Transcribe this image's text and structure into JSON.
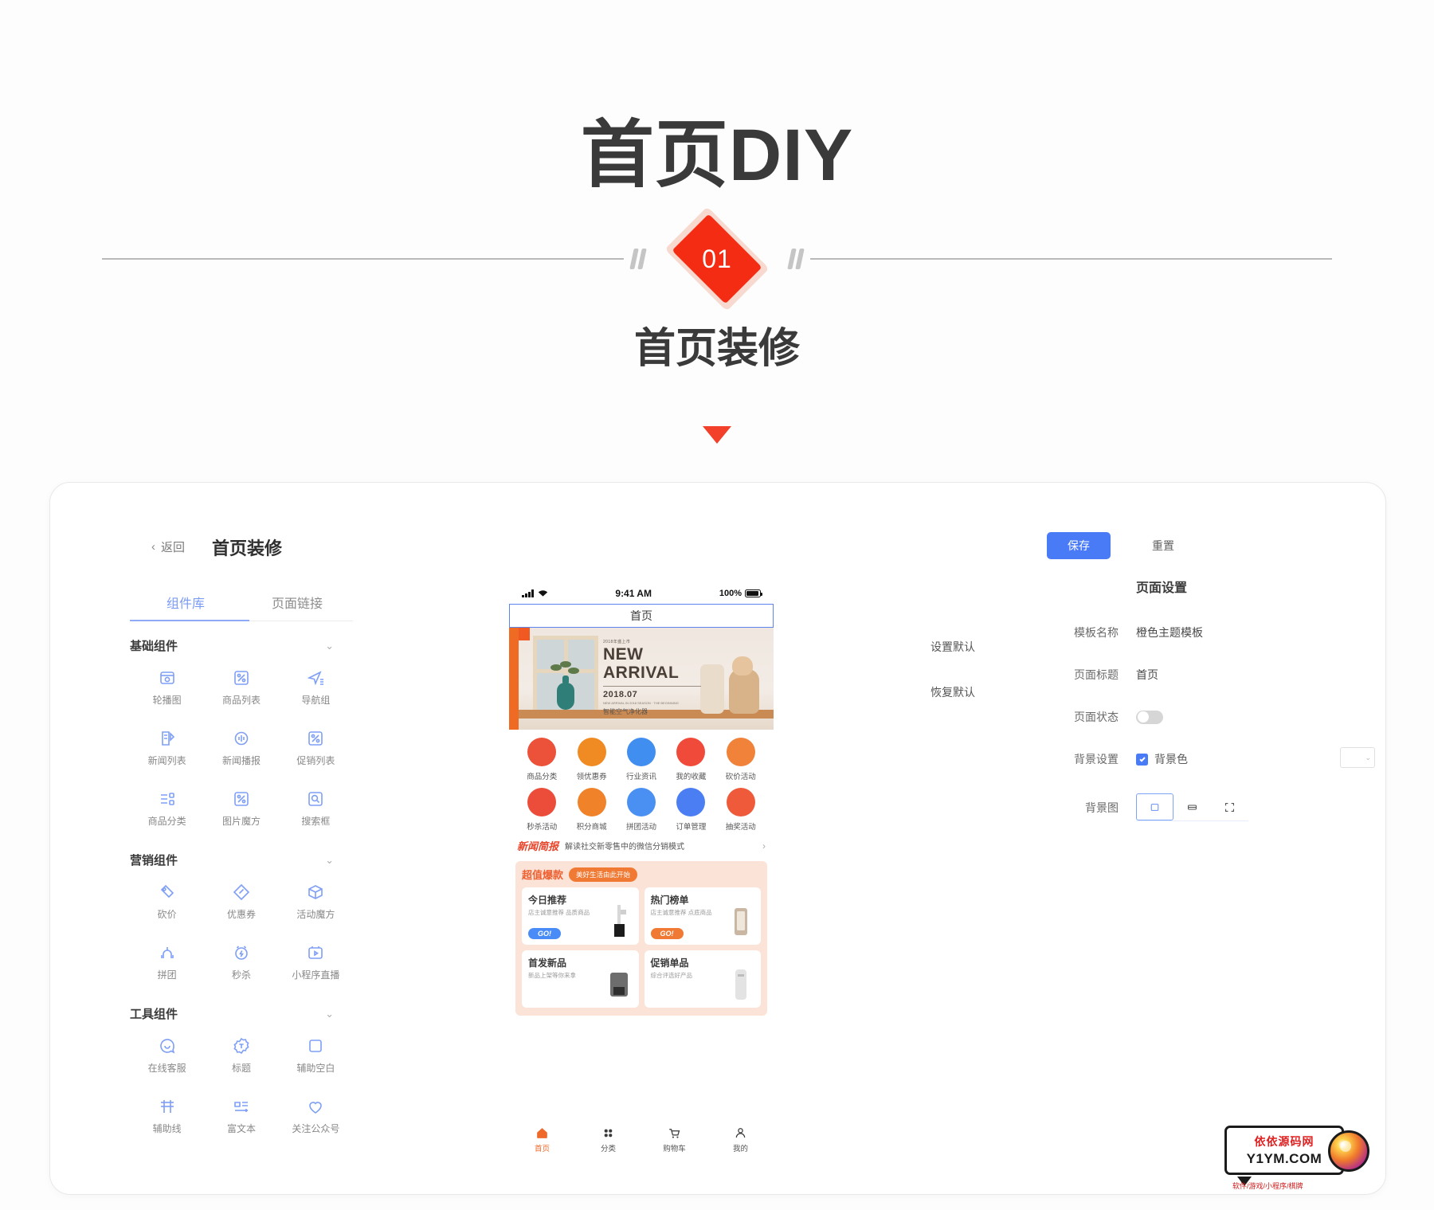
{
  "hero": {
    "title": "首页DIY",
    "badge_number": "01",
    "subtitle": "首页装修"
  },
  "app": {
    "back_label": "返回",
    "title": "首页装修",
    "save_label": "保存",
    "reset_label": "重置"
  },
  "left_panel": {
    "tabs": [
      {
        "label": "组件库",
        "active": true
      },
      {
        "label": "页面链接",
        "active": false
      }
    ],
    "groups": [
      {
        "name": "基础组件",
        "items": [
          {
            "label": "轮播图",
            "icon": "carousel-icon"
          },
          {
            "label": "商品列表",
            "icon": "product-list-icon"
          },
          {
            "label": "导航组",
            "icon": "navigation-group-icon"
          },
          {
            "label": "新闻列表",
            "icon": "news-list-icon"
          },
          {
            "label": "新闻播报",
            "icon": "news-broadcast-icon"
          },
          {
            "label": "促销列表",
            "icon": "promotion-list-icon"
          },
          {
            "label": "商品分类",
            "icon": "product-category-icon"
          },
          {
            "label": "图片魔方",
            "icon": "image-cube-icon"
          },
          {
            "label": "搜索框",
            "icon": "search-box-icon"
          }
        ]
      },
      {
        "name": "营销组件",
        "items": [
          {
            "label": "砍价",
            "icon": "bargain-icon"
          },
          {
            "label": "优惠券",
            "icon": "coupon-icon"
          },
          {
            "label": "活动魔方",
            "icon": "activity-cube-icon"
          },
          {
            "label": "拼团",
            "icon": "group-buy-icon"
          },
          {
            "label": "秒杀",
            "icon": "flash-sale-icon"
          },
          {
            "label": "小程序直播",
            "icon": "miniapp-live-icon"
          }
        ]
      },
      {
        "name": "工具组件",
        "items": [
          {
            "label": "在线客服",
            "icon": "online-service-icon"
          },
          {
            "label": "标题",
            "icon": "title-icon"
          },
          {
            "label": "辅助空白",
            "icon": "blank-space-icon"
          },
          {
            "label": "辅助线",
            "icon": "divider-line-icon"
          },
          {
            "label": "富文本",
            "icon": "rich-text-icon"
          },
          {
            "label": "关注公众号",
            "icon": "follow-official-icon"
          }
        ]
      }
    ]
  },
  "side_actions": [
    {
      "label": "设置默认"
    },
    {
      "label": "恢复默认"
    }
  ],
  "phone": {
    "status": {
      "time": "9:41 AM",
      "battery": "100%"
    },
    "nav_title": "首页",
    "banner": {
      "eyebrow": "2018年盛上市",
      "line1": "NEW",
      "line2": "ARRIVAL",
      "date": "2018.07",
      "small": "NEW ARRIVAL IN 2018 SEASON · THE BEGINNING",
      "caption": "智能空气净化器"
    },
    "icon_grid": [
      {
        "label": "商品分类",
        "color": "#ec513a"
      },
      {
        "label": "领优惠券",
        "color": "#f08a22"
      },
      {
        "label": "行业资讯",
        "color": "#3f8ef0"
      },
      {
        "label": "我的收藏",
        "color": "#ef4a3a"
      },
      {
        "label": "砍价活动",
        "color": "#f0823a"
      },
      {
        "label": "秒杀活动",
        "color": "#ec4c3a"
      },
      {
        "label": "积分商城",
        "color": "#f0832a"
      },
      {
        "label": "拼团活动",
        "color": "#4a90f2"
      },
      {
        "label": "订单管理",
        "color": "#4a7ef2"
      },
      {
        "label": "抽奖活动",
        "color": "#ee5a3a"
      }
    ],
    "news": {
      "badge": "新闻简报",
      "text": "解读社交新零售中的微信分销模式",
      "arrow": "›"
    },
    "promo": {
      "heading": "超值爆款",
      "pill": "美好生活由此开始",
      "cards": [
        {
          "title": "今日推荐",
          "desc": "店主诚意推荐 品质商品",
          "cta": "GO!",
          "cta_color": "blue"
        },
        {
          "title": "热门榜单",
          "desc": "店主诚意推荐 点底商品",
          "cta": "GO!",
          "cta_color": "orange"
        },
        {
          "title": "首发新品",
          "desc": "新品上架等你来拿",
          "cta": "",
          "cta_color": ""
        },
        {
          "title": "促销单品",
          "desc": "综合评选好产品",
          "cta": "",
          "cta_color": ""
        }
      ]
    },
    "tabbar": [
      {
        "label": "首页",
        "icon": "home-icon",
        "active": true
      },
      {
        "label": "分类",
        "icon": "category-icon",
        "active": false
      },
      {
        "label": "购物车",
        "icon": "cart-icon",
        "active": false
      },
      {
        "label": "我的",
        "icon": "user-icon",
        "active": false
      }
    ]
  },
  "right_panel": {
    "title": "页面设置",
    "template_name_label": "模板名称",
    "template_name_value": "橙色主题模板",
    "page_title_label": "页面标题",
    "page_title_value": "首页",
    "page_status_label": "页面状态",
    "page_status_on": false,
    "bg_setting_label": "背景设置",
    "bg_color_label": "背景色",
    "bg_color_checked": true,
    "bg_image_label": "背景图",
    "bg_modes": [
      {
        "icon": "contain-icon",
        "active": true
      },
      {
        "icon": "repeat-icon",
        "active": false
      },
      {
        "icon": "fullscreen-icon",
        "active": false
      }
    ]
  },
  "watermark": {
    "line1": "依依源码网",
    "line2": "Y1YM.COM",
    "line3": "软件/游戏/小程序/棋牌"
  },
  "colors": {
    "accent_blue": "#4a7bf7",
    "accent_red": "#f42c13",
    "orange": "#ef6a2a"
  }
}
